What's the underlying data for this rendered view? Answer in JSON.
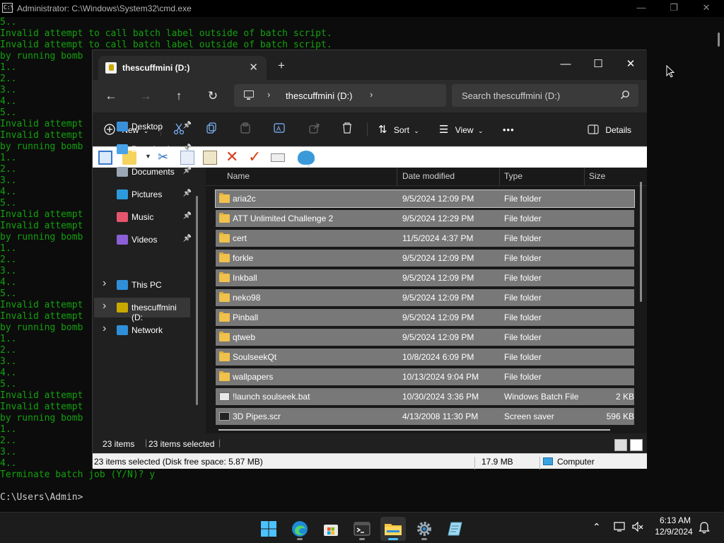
{
  "cmd": {
    "title": "Administrator: C:\\Windows\\System32\\cmd.exe",
    "icon_label": "C:\\",
    "lines": [
      {
        "t": "5..",
        "c": "g"
      },
      {
        "t": "Invalid attempt to call batch label outside of batch script.",
        "c": "g"
      },
      {
        "t": "Invalid attempt to call batch label outside of batch script.",
        "c": "g"
      },
      {
        "t": "by running bomb",
        "c": "g"
      },
      {
        "t": "1..",
        "c": "g"
      },
      {
        "t": "2..",
        "c": "g"
      },
      {
        "t": "3..",
        "c": "g"
      },
      {
        "t": "4..",
        "c": "g"
      },
      {
        "t": "5..",
        "c": "g"
      },
      {
        "t": "Invalid attempt",
        "c": "g"
      },
      {
        "t": "Invalid attempt",
        "c": "g"
      },
      {
        "t": "by running bomb",
        "c": "g"
      },
      {
        "t": "1..",
        "c": "g"
      },
      {
        "t": "2..",
        "c": "g"
      },
      {
        "t": "3..",
        "c": "g"
      },
      {
        "t": "4..",
        "c": "g"
      },
      {
        "t": "5..",
        "c": "g"
      },
      {
        "t": "Invalid attempt",
        "c": "g"
      },
      {
        "t": "Invalid attempt",
        "c": "g"
      },
      {
        "t": "by running bomb",
        "c": "g"
      },
      {
        "t": "1..",
        "c": "g"
      },
      {
        "t": "2..",
        "c": "g"
      },
      {
        "t": "3..",
        "c": "g"
      },
      {
        "t": "4..",
        "c": "g"
      },
      {
        "t": "5..",
        "c": "g"
      },
      {
        "t": "Invalid attempt",
        "c": "g"
      },
      {
        "t": "Invalid attempt",
        "c": "g"
      },
      {
        "t": "by running bomb",
        "c": "g"
      },
      {
        "t": "1..",
        "c": "g"
      },
      {
        "t": "2..",
        "c": "g"
      },
      {
        "t": "3..",
        "c": "g"
      },
      {
        "t": "4..",
        "c": "g"
      },
      {
        "t": "5..",
        "c": "g"
      },
      {
        "t": "Invalid attempt",
        "c": "g"
      },
      {
        "t": "Invalid attempt",
        "c": "g"
      },
      {
        "t": "by running bomb",
        "c": "g"
      },
      {
        "t": "1..",
        "c": "g"
      },
      {
        "t": "2..",
        "c": "g"
      },
      {
        "t": "3..",
        "c": "g"
      },
      {
        "t": "4..",
        "c": "g"
      },
      {
        "t": "Terminate batch job (Y/N)? y",
        "c": "g"
      },
      {
        "t": "",
        "c": "g"
      },
      {
        "t": "C:\\Users\\Admin>",
        "c": "w"
      }
    ]
  },
  "explorer": {
    "tab_title": "thescuffmini (D:)",
    "address_location": "thescuffmini (D:)",
    "search_placeholder": "Search thescuffmini (D:)",
    "toolbar": {
      "new_label": "New",
      "sort_label": "Sort",
      "view_label": "View",
      "more_label": "•••",
      "details_label": "Details"
    },
    "nav": [
      {
        "label": "Desktop",
        "icon": "desktop-icon",
        "color": "#3b8fd9",
        "pinned": true
      },
      {
        "label": "Downloads",
        "icon": "download-icon",
        "color": "#49a3e8",
        "pinned": true
      },
      {
        "label": "Documents",
        "icon": "document-icon",
        "color": "#9aa7b4",
        "pinned": true
      },
      {
        "label": "Pictures",
        "icon": "pictures-icon",
        "color": "#2d9bdb",
        "pinned": true
      },
      {
        "label": "Music",
        "icon": "music-icon",
        "color": "#e4566d",
        "pinned": true
      },
      {
        "label": "Videos",
        "icon": "video-icon",
        "color": "#8b5fd6",
        "pinned": true
      },
      {
        "label": "This PC",
        "icon": "pc-icon",
        "color": "#2f8fd8",
        "expandable": true
      },
      {
        "label": "thescuffmini (D:",
        "icon": "drive-icon",
        "color": "#c9a800",
        "expandable": true,
        "selected": true
      },
      {
        "label": "Network",
        "icon": "network-icon",
        "color": "#2f8fd8",
        "expandable": true
      }
    ],
    "columns": {
      "name": "Name",
      "date": "Date modified",
      "type": "Type",
      "size": "Size"
    },
    "files": [
      {
        "name": "aria2c",
        "date": "9/5/2024 12:09 PM",
        "type": "File folder",
        "size": "",
        "kind": "folder"
      },
      {
        "name": "ATT Unlimited Challenge 2",
        "date": "9/5/2024 12:29 PM",
        "type": "File folder",
        "size": "",
        "kind": "folder"
      },
      {
        "name": "cert",
        "date": "11/5/2024 4:37 PM",
        "type": "File folder",
        "size": "",
        "kind": "folder"
      },
      {
        "name": "forkle",
        "date": "9/5/2024 12:09 PM",
        "type": "File folder",
        "size": "",
        "kind": "folder"
      },
      {
        "name": "Inkball",
        "date": "9/5/2024 12:09 PM",
        "type": "File folder",
        "size": "",
        "kind": "folder"
      },
      {
        "name": "neko98",
        "date": "9/5/2024 12:09 PM",
        "type": "File folder",
        "size": "",
        "kind": "folder"
      },
      {
        "name": "Pinball",
        "date": "9/5/2024 12:09 PM",
        "type": "File folder",
        "size": "",
        "kind": "folder"
      },
      {
        "name": "qtweb",
        "date": "9/5/2024 12:09 PM",
        "type": "File folder",
        "size": "",
        "kind": "folder"
      },
      {
        "name": "SoulseekQt",
        "date": "10/8/2024 6:09 PM",
        "type": "File folder",
        "size": "",
        "kind": "folder"
      },
      {
        "name": "wallpapers",
        "date": "10/13/2024 9:04 PM",
        "type": "File folder",
        "size": "",
        "kind": "folder"
      },
      {
        "name": "!launch soulseek.bat",
        "date": "10/30/2024 3:36 PM",
        "type": "Windows Batch File",
        "size": "2 KB",
        "kind": "bat"
      },
      {
        "name": "3D Pipes.scr",
        "date": "4/13/2008 11:30 PM",
        "type": "Screen saver",
        "size": "596 KB",
        "kind": "scr"
      }
    ],
    "status": {
      "items": "23 items",
      "selected": "23 items selected"
    },
    "classic_status": {
      "selection": "23 items selected (Disk free space: 5.87 MB)",
      "size": "17.9 MB",
      "location": "Computer"
    }
  },
  "taskbar": {
    "apps": [
      "start-icon",
      "edge-icon",
      "store-icon",
      "terminal-icon",
      "file-explorer-icon",
      "settings-icon",
      "notepad-icon"
    ],
    "time": "6:13 AM",
    "date": "12/9/2024"
  }
}
